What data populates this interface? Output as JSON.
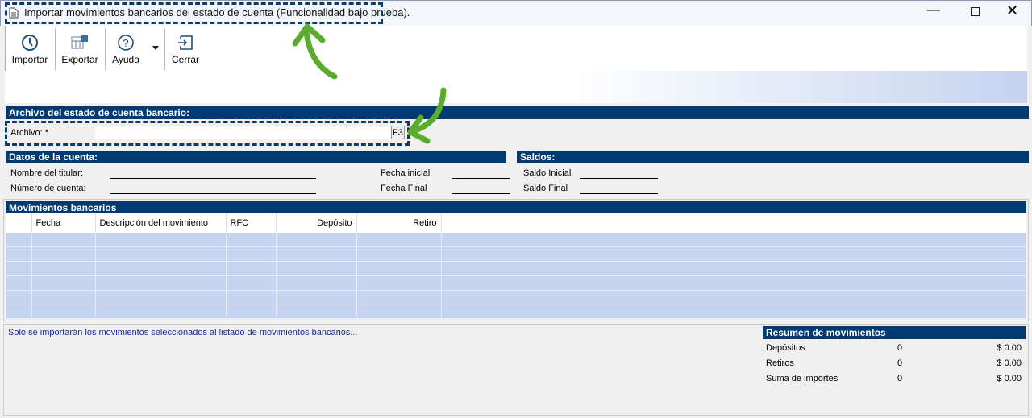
{
  "window": {
    "title": "Importar movimientos bancarios del estado de cuenta (Funcionalidad bajo prueba)."
  },
  "toolbar": {
    "importar": "Importar",
    "exportar": "Exportar",
    "ayuda": "Ayuda",
    "cerrar": "Cerrar"
  },
  "archivo": {
    "header": "Archivo del estado de cuenta bancario:",
    "label": "Archivo: *",
    "value": "",
    "f3": "F3"
  },
  "datos": {
    "header": "Datos de la cuenta:",
    "nombre": "Nombre del titular:",
    "numero": "Número de cuenta:",
    "fecha_inicial": "Fecha inicial",
    "fecha_final": "Fecha Final"
  },
  "saldos": {
    "header": "Saldos:",
    "inicial": "Saldo Inicial",
    "final": "Saldo Final"
  },
  "movimientos": {
    "header": "Movimientos bancarios",
    "columns": [
      "",
      "Fecha",
      "Descripción del movimiento",
      "RFC",
      "Depósito",
      "Retiro",
      ""
    ]
  },
  "footer": {
    "note": "Solo se importarán los movimientos seleccionados al listado de movimientos bancarios..."
  },
  "resumen": {
    "header": "Resumen de movimientos",
    "rows": [
      {
        "label": "Depósitos",
        "count": "0",
        "amount": "$ 0.00"
      },
      {
        "label": "Retiros",
        "count": "0",
        "amount": "$ 0.00"
      },
      {
        "label": "Suma de importes",
        "count": "0",
        "amount": "$ 0.00"
      }
    ]
  },
  "colors": {
    "header": "#003a70",
    "row": "#c5d4ef",
    "arrow": "#5aac2e"
  }
}
